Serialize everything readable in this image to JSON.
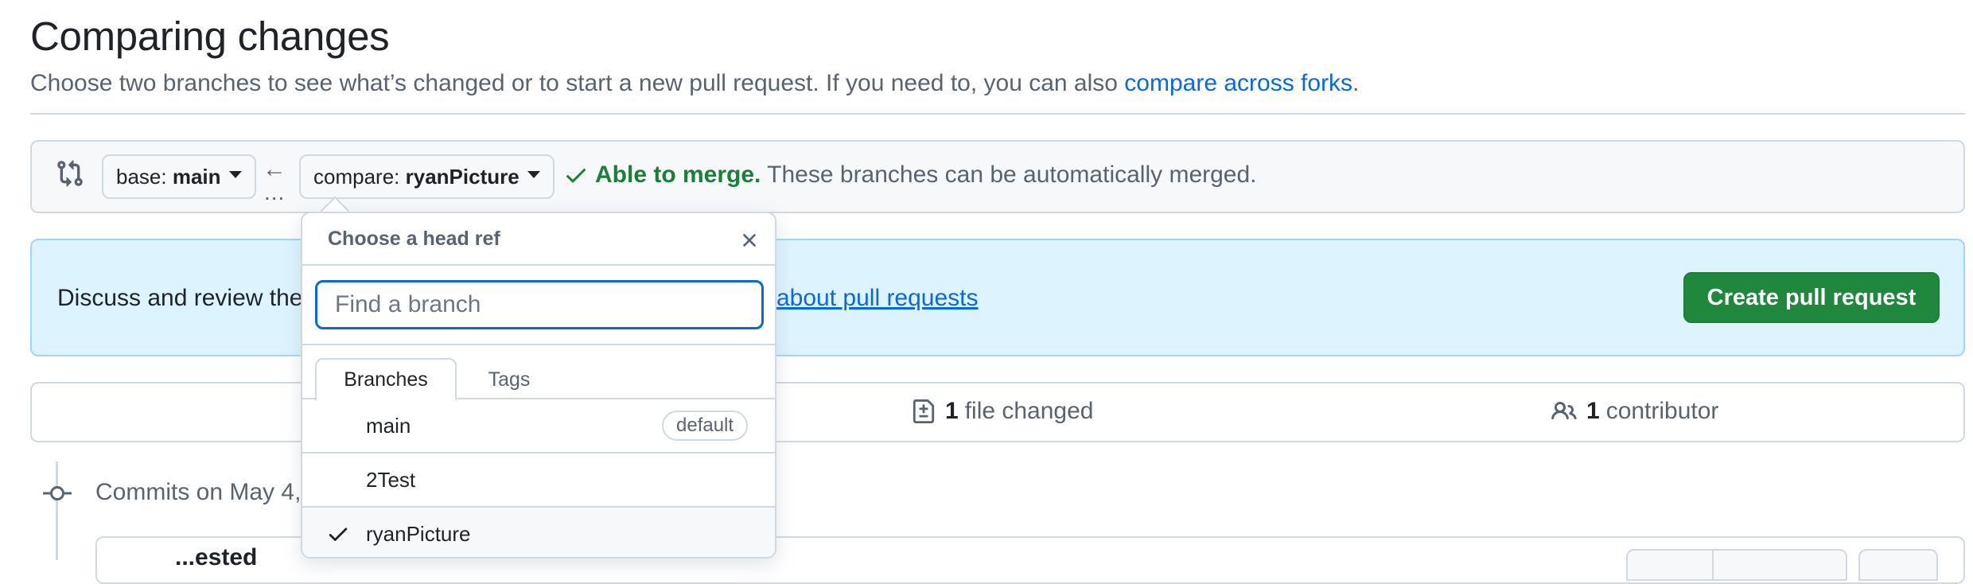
{
  "header": {
    "title": "Comparing changes",
    "subtitle": "Choose two branches to see what’s changed or to start a new pull request. If you need to, you can also",
    "subtitle_link": "compare across forks",
    "subtitle_end": "."
  },
  "range": {
    "base_prefix": "base: ",
    "base_value": "main",
    "compare_prefix": "compare: ",
    "compare_value": "ryanPicture",
    "arrow": "←",
    "dots": "...",
    "merge_status": "Able to merge.",
    "merge_detail": "These branches can be automatically merged."
  },
  "notice": {
    "text": "Discuss and review the",
    "link": "about pull requests",
    "button": "Create pull request"
  },
  "stats": {
    "files_count": "1",
    "files_label": "file changed",
    "contributors_count": "1",
    "contributors_label": "contributor"
  },
  "commits": {
    "label": "Commits on May 4,",
    "first_commit_fragment": "...ested"
  },
  "dropdown": {
    "title": "Choose a head ref",
    "search_placeholder": "Find a branch",
    "tabs": [
      "Branches",
      "Tags"
    ],
    "items": [
      {
        "label": "main",
        "badge": "default",
        "selected": false
      },
      {
        "label": "2Test",
        "badge": "",
        "selected": false
      },
      {
        "label": "ryanPicture",
        "badge": "",
        "selected": true
      }
    ]
  },
  "colors": {
    "accent": "#0969da",
    "success": "#1a7f37",
    "primary_button": "#1f883d",
    "notice_bg": "#ddf4ff"
  },
  "icons": [
    "git-compare-icon",
    "arrow-left-icon",
    "check-icon",
    "close-icon",
    "file-diff-icon",
    "people-icon",
    "git-commit-icon"
  ]
}
